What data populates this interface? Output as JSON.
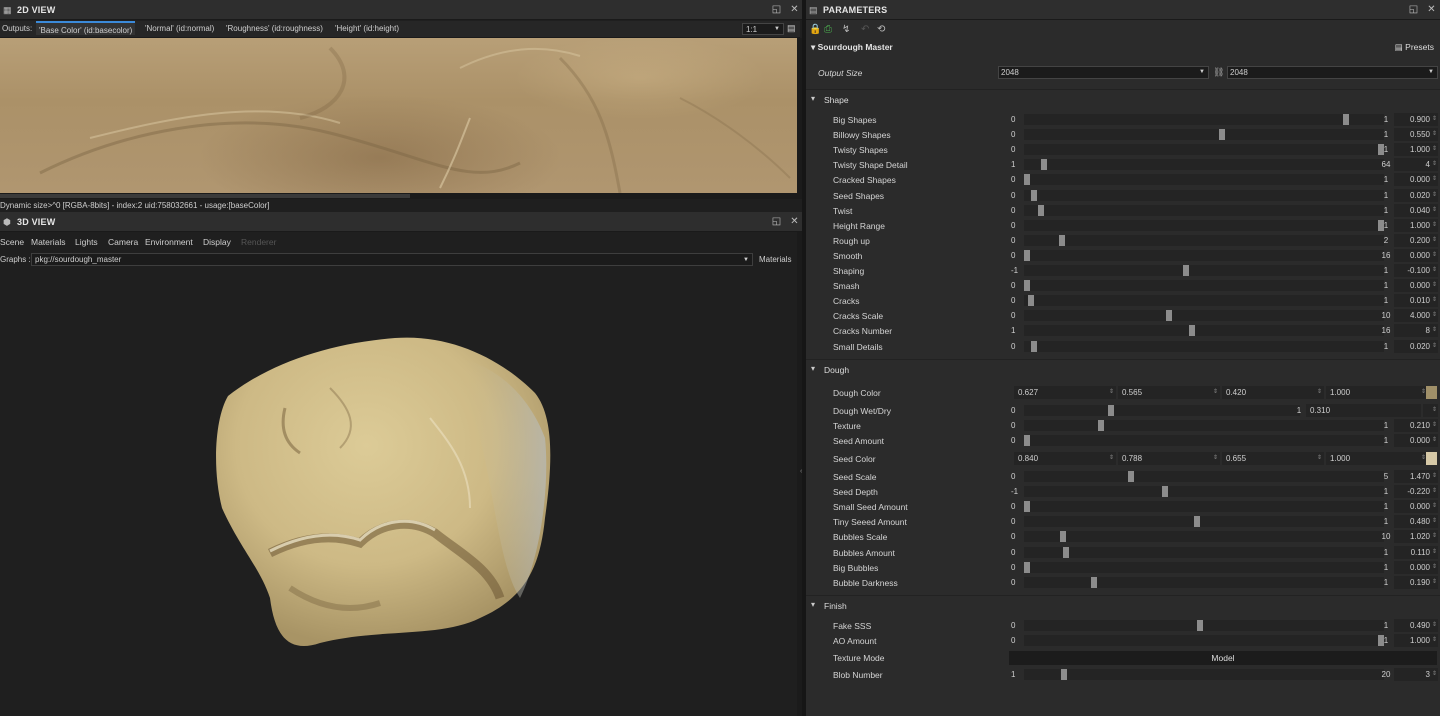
{
  "view2d": {
    "title": "2D VIEW",
    "outputs_label": "Outputs:",
    "tabs": [
      "'Base Color' (id:basecolor)",
      "'Normal' (id:normal)",
      "'Roughness' (id:roughness)",
      "'Height' (id:height)"
    ],
    "zoom": "1:1",
    "info": "Dynamic size>^0 [RGBA-8bits] - index:2 uid:758032661 - usage:[baseColor]"
  },
  "view3d": {
    "title": "3D VIEW",
    "menu": [
      "Scene",
      "Materials",
      "Lights",
      "Camera",
      "Environment",
      "Display",
      "Renderer"
    ],
    "graphs_label": "Graphs :",
    "graph_value": "pkg://sourdough_master",
    "materials_label": "Materials"
  },
  "params": {
    "title": "PARAMETERS",
    "graph_name": "Sourdough Master",
    "presets_label": "Presets",
    "output_size_label": "Output Size",
    "output_size_w": "2048",
    "output_size_h": "2048",
    "sections": {
      "shape": "Shape",
      "dough": "Dough",
      "finish": "Finish"
    },
    "shape_rows": [
      {
        "label": "Big Shapes",
        "min": "0",
        "max": "1",
        "value": "0.900",
        "frac": 0.9
      },
      {
        "label": "Billowy Shapes",
        "min": "0",
        "max": "1",
        "value": "0.550",
        "frac": 0.55
      },
      {
        "label": "Twisty Shapes",
        "min": "0",
        "max": "1",
        "value": "1.000",
        "frac": 1.0
      },
      {
        "label": "Twisty Shape Detail",
        "min": "1",
        "max": "64",
        "value": "4",
        "frac": 0.048
      },
      {
        "label": "Cracked Shapes",
        "min": "0",
        "max": "1",
        "value": "0.000",
        "frac": 0.0
      },
      {
        "label": "Seed Shapes",
        "min": "0",
        "max": "1",
        "value": "0.020",
        "frac": 0.02
      },
      {
        "label": "Twist",
        "min": "0",
        "max": "1",
        "value": "0.040",
        "frac": 0.04
      },
      {
        "label": "Height Range",
        "min": "0",
        "max": "1",
        "value": "1.000",
        "frac": 1.0
      },
      {
        "label": "Rough up",
        "min": "0",
        "max": "2",
        "value": "0.200",
        "frac": 0.1
      },
      {
        "label": "Smooth",
        "min": "0",
        "max": "16",
        "value": "0.000",
        "frac": 0.0
      },
      {
        "label": "Shaping",
        "min": "-1",
        "max": "1",
        "value": "-0.100",
        "frac": 0.45
      },
      {
        "label": "Smash",
        "min": "0",
        "max": "1",
        "value": "0.000",
        "frac": 0.0
      },
      {
        "label": "Cracks",
        "min": "0",
        "max": "1",
        "value": "0.010",
        "frac": 0.01
      },
      {
        "label": "Cracks Scale",
        "min": "0",
        "max": "10",
        "value": "4.000",
        "frac": 0.4
      },
      {
        "label": "Cracks Number",
        "min": "1",
        "max": "16",
        "value": "8",
        "frac": 0.467
      },
      {
        "label": "Small Details",
        "min": "0",
        "max": "1",
        "value": "0.020",
        "frac": 0.02
      }
    ],
    "dough_color": {
      "label": "Dough Color",
      "values": [
        "0.627",
        "0.565",
        "0.420",
        "1.000"
      ],
      "swatch": "#a09069"
    },
    "dough_rows_a": [
      {
        "label": "Dough Wet/Dry",
        "min": "0",
        "max": "1",
        "value": "0.310",
        "frac": 0.31,
        "short": true
      },
      {
        "label": "Texture",
        "min": "0",
        "max": "1",
        "value": "0.210",
        "frac": 0.21
      },
      {
        "label": "Seed Amount",
        "min": "0",
        "max": "1",
        "value": "0.000",
        "frac": 0.0
      }
    ],
    "seed_color": {
      "label": "Seed Color",
      "values": [
        "0.840",
        "0.788",
        "0.655",
        "1.000"
      ],
      "swatch": "#d6c9a7"
    },
    "dough_rows_b": [
      {
        "label": "Seed Scale",
        "min": "0",
        "max": "5",
        "value": "1.470",
        "frac": 0.294
      },
      {
        "label": "Seed Depth",
        "min": "-1",
        "max": "1",
        "value": "-0.220",
        "frac": 0.39
      },
      {
        "label": "Small Seed Amount",
        "min": "0",
        "max": "1",
        "value": "0.000",
        "frac": 0.0
      },
      {
        "label": "Tiny Seeed Amount",
        "min": "0",
        "max": "1",
        "value": "0.480",
        "frac": 0.48
      },
      {
        "label": "Bubbles Scale",
        "min": "0",
        "max": "10",
        "value": "1.020",
        "frac": 0.102
      },
      {
        "label": "Bubbles Amount",
        "min": "0",
        "max": "1",
        "value": "0.110",
        "frac": 0.11
      },
      {
        "label": "Big Bubbles",
        "min": "0",
        "max": "1",
        "value": "0.000",
        "frac": 0.0
      },
      {
        "label": "Bubble Darkness",
        "min": "0",
        "max": "1",
        "value": "0.190",
        "frac": 0.19
      }
    ],
    "finish_rows": [
      {
        "label": "Fake SSS",
        "min": "0",
        "max": "1",
        "value": "0.490",
        "frac": 0.49
      },
      {
        "label": "AO Amount",
        "min": "0",
        "max": "1",
        "value": "1.000",
        "frac": 1.0
      }
    ],
    "texture_mode": {
      "label": "Texture Mode",
      "value": "Model"
    },
    "blob_number": {
      "label": "Blob Number",
      "min": "1",
      "max": "20",
      "value": "3",
      "frac": 0.105
    }
  }
}
